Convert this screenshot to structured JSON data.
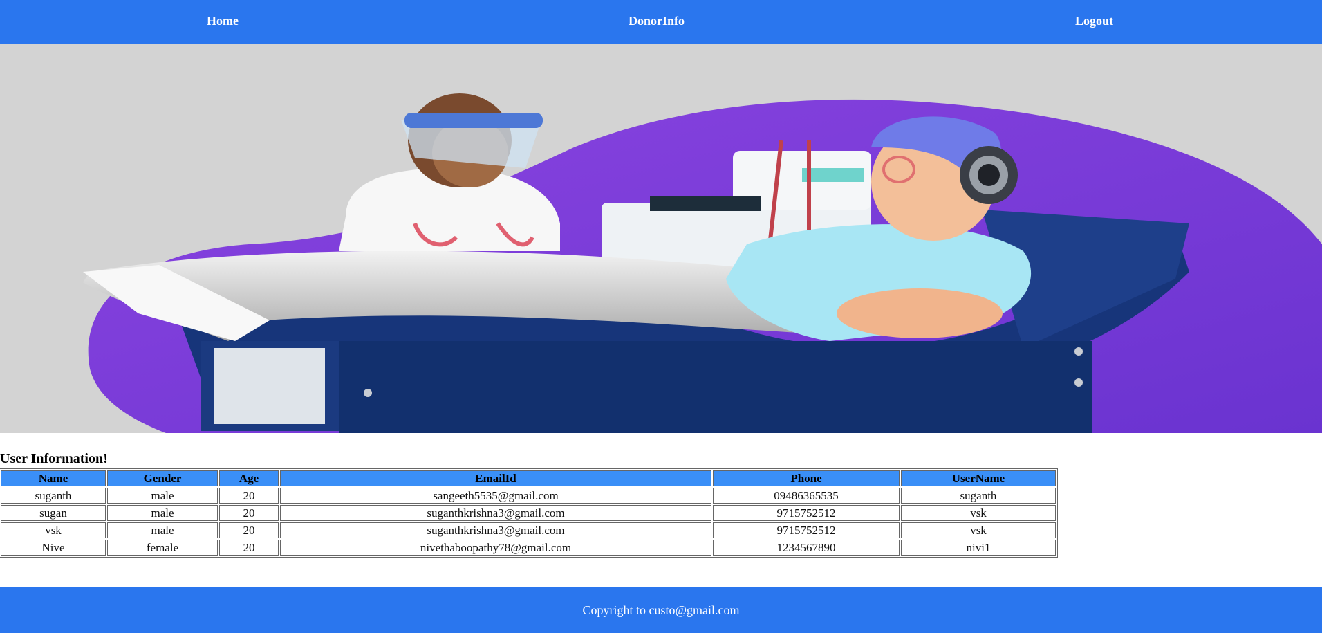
{
  "nav": {
    "home": "Home",
    "donor_info": "DonorInfo",
    "logout": "Logout"
  },
  "hero": {
    "image": "doctor-and-blood-donor-illustration"
  },
  "section": {
    "title": "User Information!"
  },
  "table": {
    "headers": [
      "Name",
      "Gender",
      "Age",
      "EmailId",
      "Phone",
      "UserName"
    ],
    "rows": [
      [
        "suganth",
        "male",
        "20",
        "sangeeth5535@gmail.com",
        "09486365535",
        "suganth"
      ],
      [
        "sugan",
        "male",
        "20",
        "suganthkrishna3@gmail.com",
        "9715752512",
        "vsk"
      ],
      [
        "vsk",
        "male",
        "20",
        "suganthkrishna3@gmail.com",
        "9715752512",
        "vsk"
      ],
      [
        "Nive",
        "female",
        "20",
        "nivethaboopathy78@gmail.com",
        "1234567890",
        "nivi1"
      ]
    ]
  },
  "footer": {
    "text": "Copyright to custo@gmail.com"
  },
  "colors": {
    "nav_bg": "#2a76ee",
    "header_cell_bg": "#3a8ff7",
    "hero_bg": "#d3d3d3",
    "blob": "#7b3fe4",
    "chair": "#17357a"
  }
}
